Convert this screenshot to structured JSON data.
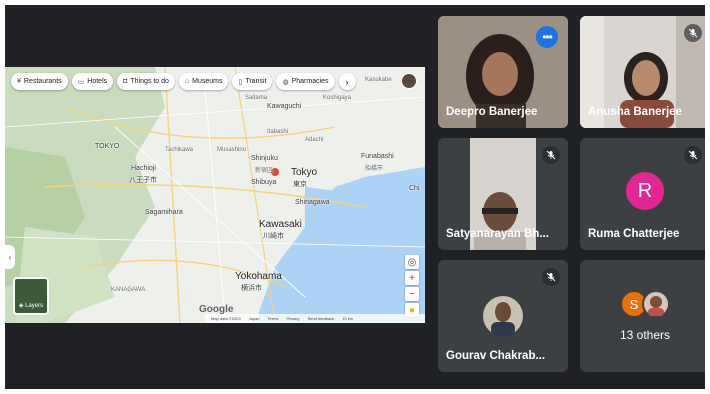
{
  "map": {
    "chips": [
      {
        "icon": "fork-knife-icon",
        "glyph": "¥",
        "label": "Restaurants"
      },
      {
        "icon": "bed-icon",
        "glyph": "▭",
        "label": "Hotels"
      },
      {
        "icon": "camera-icon",
        "glyph": "◘",
        "label": "Things to do"
      },
      {
        "icon": "museum-icon",
        "glyph": "⌂",
        "label": "Museums"
      },
      {
        "icon": "train-icon",
        "glyph": "▯",
        "label": "Transit"
      },
      {
        "icon": "pill-icon",
        "glyph": "◍",
        "label": "Pharmacies"
      }
    ],
    "places": {
      "saitama": "Saitama",
      "koshigaya": "Koshigaya",
      "kasukabe": "Kasukabe",
      "kawaguchi": "Kawaguchi",
      "itabashi": "Itabashi",
      "adachi": "Adachi",
      "tokyo_west": "TOKYO",
      "shinjuku": "Shinjuku",
      "shinjuku_jp": "新宿区",
      "tokyo": "Tokyo",
      "tokyo_jp": "東京",
      "funabashi": "Funabashi",
      "funabashi_jp": "船橋市",
      "hachioji": "Hachioji",
      "hachioji_jp": "八王子市",
      "shibuya": "Shibuya",
      "shinagawa": "Shinagawa",
      "sagamihara": "Sagamihara",
      "kawasaki": "Kawasaki",
      "kawasaki_jp": "川崎市",
      "yokohama": "Yokohama",
      "yokohama_jp": "横浜市",
      "kanagawa": "KANAGAWA",
      "tachikawa": "Tachikawa",
      "musashino": "Musashino",
      "chiba": "Chi"
    },
    "layers_label": "Layers",
    "google_logo": "Google",
    "footer": [
      "Map data ©2023",
      "Japan",
      "Terms",
      "Privacy",
      "Send feedback",
      "10 km"
    ]
  },
  "participants": [
    {
      "name": "Deepro Banerjee",
      "speaking": true
    },
    {
      "name": "Anusha Banerjee",
      "muted": true
    },
    {
      "name": "Satyanarayan Bh...",
      "muted": true
    },
    {
      "name": "Ruma Chatterjee",
      "initial": "R",
      "muted": true
    },
    {
      "name": "Gourav Chakrab...",
      "muted": true
    },
    {
      "name": "13 others",
      "initial": "S"
    }
  ],
  "colors": {
    "background": "#202124",
    "tile": "#3c4043",
    "accent": "#1a73e8",
    "speaking_ring": "#8ab4f8",
    "ruma_avatar": "#e52592",
    "others_avatar": "#e8710a"
  }
}
